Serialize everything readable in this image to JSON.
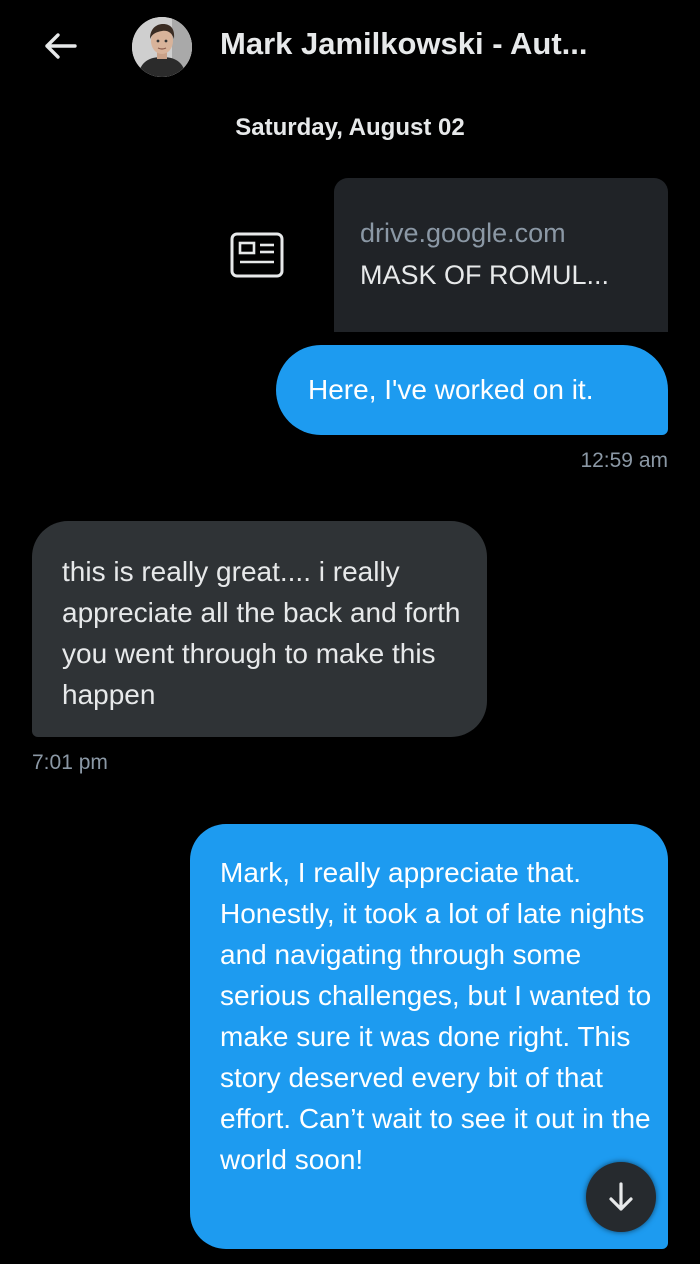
{
  "header": {
    "back_icon": "arrow-left-icon",
    "avatar_icon": "person-photo",
    "title": "Mark Jamilkowski - Aut..."
  },
  "conversation": {
    "date_separator": "Saturday, August 02",
    "messages": [
      {
        "direction": "sent",
        "type": "link",
        "icon": "article-icon",
        "domain": "drive.google.com",
        "title": "MASK OF ROMUL..."
      },
      {
        "direction": "sent",
        "type": "text",
        "text": "Here, I've worked on it.",
        "time": "12:59 am"
      },
      {
        "direction": "received",
        "type": "text",
        "text": "this is really great.... i really appreciate all the back and forth you went through to make this happen",
        "time": "7:01 pm"
      },
      {
        "direction": "sent",
        "type": "text",
        "text": "Mark, I really appreciate that. Honestly, it took a lot of late nights and navigating through some serious challenges, but I wanted to make sure it was done right. This story deserved every bit of that effort. Can’t wait to see it out in the world soon!"
      }
    ]
  },
  "scroll_button": {
    "icon": "arrow-down-icon"
  },
  "colors": {
    "background": "#000000",
    "sent_bubble": "#1d9bf0",
    "received_bubble": "#2f3336",
    "card_background": "#202327",
    "secondary_text": "#8b98a5"
  }
}
